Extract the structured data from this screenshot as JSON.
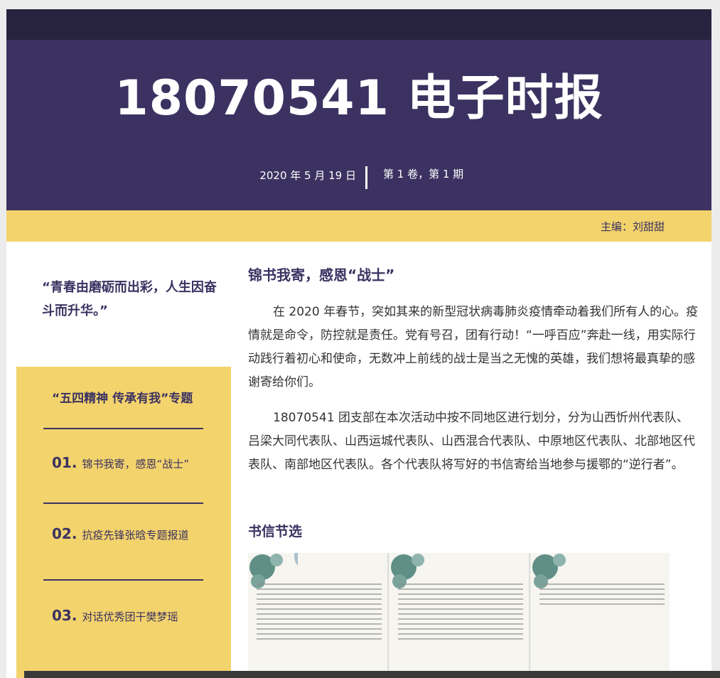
{
  "masthead": {
    "title": "18070541 电子时报",
    "date": "2020 年 5 月 19 日",
    "issue": "第 1 卷，第 1 期",
    "editor": "主编：刘甜甜"
  },
  "sidebar": {
    "quote": "“青春由磨砺而出彩，人生因奋斗而升华。”",
    "box_title": "“五四精神 传承有我”专题",
    "items": [
      {
        "num": "01.",
        "label": "锦书我寄，感恩“战士”"
      },
      {
        "num": "02.",
        "label": "抗疫先锋张晗专题报道"
      },
      {
        "num": "03.",
        "label": "对话优秀团干樊梦瑶"
      }
    ]
  },
  "article": {
    "title": "锦书我寄，感恩“战士”",
    "paragraphs": [
      "在 2020 年春节，突如其来的新型冠状病毒肺炎疫情牵动着我们所有人的心。疫情就是命令，防控就是责任。党有号召，团有行动！“一呼百应”奔赴一线，用实际行动践行着初心和使命，无数冲上前线的战士是当之无愧的英雄，我们想将最真挚的感谢寄给你们。",
      "18070541 团支部在本次活动中按不同地区进行划分，分为山西忻州代表队、吕梁大同代表队、山西运城代表队、山西混合代表队、中原地区代表队、北部地区代表队、南部地区代表队。各个代表队将写好的书信寄给当地参与援鄂的“逆行者”。"
    ],
    "section_title": "书信节选"
  },
  "colors": {
    "dark": "#27233f",
    "purple": "#3b3261",
    "yellow": "#f3d36c"
  }
}
